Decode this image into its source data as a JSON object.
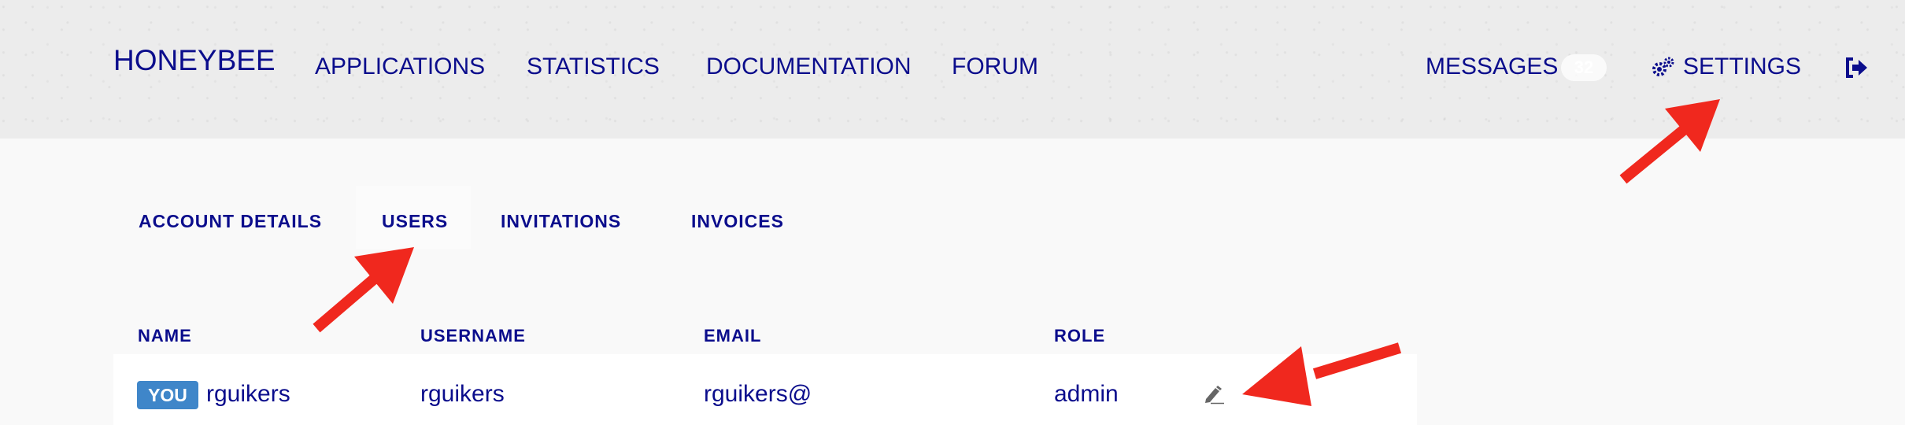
{
  "header": {
    "brand": "HONEYBEE",
    "nav": [
      "APPLICATIONS",
      "STATISTICS",
      "DOCUMENTATION",
      "FORUM"
    ],
    "messages_label": "MESSAGES",
    "messages_count": "32",
    "settings_label": "SETTINGS",
    "settings_icon": "gears-icon",
    "logout_icon": "sign-out-icon"
  },
  "tabs": [
    "ACCOUNT DETAILS",
    "USERS",
    "INVITATIONS",
    "INVOICES"
  ],
  "active_tab": "USERS",
  "table": {
    "columns": [
      "NAME",
      "USERNAME",
      "EMAIL",
      "ROLE"
    ],
    "rows": [
      {
        "badge": "YOU",
        "name": "rguikers",
        "username": "rguikers",
        "email": "rguikers@",
        "role": "admin",
        "action_icon": "pencil-icon"
      }
    ]
  },
  "annotations": {
    "arrow_color": "#f0281e"
  },
  "colors": {
    "text": "#0b0d8c",
    "badge_you": "#3f86c9"
  }
}
